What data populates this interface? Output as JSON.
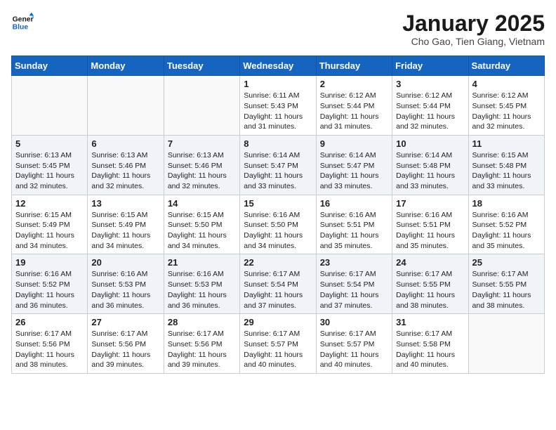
{
  "header": {
    "logo_line1": "General",
    "logo_line2": "Blue",
    "title": "January 2025",
    "location": "Cho Gao, Tien Giang, Vietnam"
  },
  "days_of_week": [
    "Sunday",
    "Monday",
    "Tuesday",
    "Wednesday",
    "Thursday",
    "Friday",
    "Saturday"
  ],
  "weeks": [
    [
      {
        "day": "",
        "sunrise": "",
        "sunset": "",
        "daylight": ""
      },
      {
        "day": "",
        "sunrise": "",
        "sunset": "",
        "daylight": ""
      },
      {
        "day": "",
        "sunrise": "",
        "sunset": "",
        "daylight": ""
      },
      {
        "day": "1",
        "sunrise": "Sunrise: 6:11 AM",
        "sunset": "Sunset: 5:43 PM",
        "daylight": "Daylight: 11 hours and 31 minutes."
      },
      {
        "day": "2",
        "sunrise": "Sunrise: 6:12 AM",
        "sunset": "Sunset: 5:44 PM",
        "daylight": "Daylight: 11 hours and 31 minutes."
      },
      {
        "day": "3",
        "sunrise": "Sunrise: 6:12 AM",
        "sunset": "Sunset: 5:44 PM",
        "daylight": "Daylight: 11 hours and 32 minutes."
      },
      {
        "day": "4",
        "sunrise": "Sunrise: 6:12 AM",
        "sunset": "Sunset: 5:45 PM",
        "daylight": "Daylight: 11 hours and 32 minutes."
      }
    ],
    [
      {
        "day": "5",
        "sunrise": "Sunrise: 6:13 AM",
        "sunset": "Sunset: 5:45 PM",
        "daylight": "Daylight: 11 hours and 32 minutes."
      },
      {
        "day": "6",
        "sunrise": "Sunrise: 6:13 AM",
        "sunset": "Sunset: 5:46 PM",
        "daylight": "Daylight: 11 hours and 32 minutes."
      },
      {
        "day": "7",
        "sunrise": "Sunrise: 6:13 AM",
        "sunset": "Sunset: 5:46 PM",
        "daylight": "Daylight: 11 hours and 32 minutes."
      },
      {
        "day": "8",
        "sunrise": "Sunrise: 6:14 AM",
        "sunset": "Sunset: 5:47 PM",
        "daylight": "Daylight: 11 hours and 33 minutes."
      },
      {
        "day": "9",
        "sunrise": "Sunrise: 6:14 AM",
        "sunset": "Sunset: 5:47 PM",
        "daylight": "Daylight: 11 hours and 33 minutes."
      },
      {
        "day": "10",
        "sunrise": "Sunrise: 6:14 AM",
        "sunset": "Sunset: 5:48 PM",
        "daylight": "Daylight: 11 hours and 33 minutes."
      },
      {
        "day": "11",
        "sunrise": "Sunrise: 6:15 AM",
        "sunset": "Sunset: 5:48 PM",
        "daylight": "Daylight: 11 hours and 33 minutes."
      }
    ],
    [
      {
        "day": "12",
        "sunrise": "Sunrise: 6:15 AM",
        "sunset": "Sunset: 5:49 PM",
        "daylight": "Daylight: 11 hours and 34 minutes."
      },
      {
        "day": "13",
        "sunrise": "Sunrise: 6:15 AM",
        "sunset": "Sunset: 5:49 PM",
        "daylight": "Daylight: 11 hours and 34 minutes."
      },
      {
        "day": "14",
        "sunrise": "Sunrise: 6:15 AM",
        "sunset": "Sunset: 5:50 PM",
        "daylight": "Daylight: 11 hours and 34 minutes."
      },
      {
        "day": "15",
        "sunrise": "Sunrise: 6:16 AM",
        "sunset": "Sunset: 5:50 PM",
        "daylight": "Daylight: 11 hours and 34 minutes."
      },
      {
        "day": "16",
        "sunrise": "Sunrise: 6:16 AM",
        "sunset": "Sunset: 5:51 PM",
        "daylight": "Daylight: 11 hours and 35 minutes."
      },
      {
        "day": "17",
        "sunrise": "Sunrise: 6:16 AM",
        "sunset": "Sunset: 5:51 PM",
        "daylight": "Daylight: 11 hours and 35 minutes."
      },
      {
        "day": "18",
        "sunrise": "Sunrise: 6:16 AM",
        "sunset": "Sunset: 5:52 PM",
        "daylight": "Daylight: 11 hours and 35 minutes."
      }
    ],
    [
      {
        "day": "19",
        "sunrise": "Sunrise: 6:16 AM",
        "sunset": "Sunset: 5:52 PM",
        "daylight": "Daylight: 11 hours and 36 minutes."
      },
      {
        "day": "20",
        "sunrise": "Sunrise: 6:16 AM",
        "sunset": "Sunset: 5:53 PM",
        "daylight": "Daylight: 11 hours and 36 minutes."
      },
      {
        "day": "21",
        "sunrise": "Sunrise: 6:16 AM",
        "sunset": "Sunset: 5:53 PM",
        "daylight": "Daylight: 11 hours and 36 minutes."
      },
      {
        "day": "22",
        "sunrise": "Sunrise: 6:17 AM",
        "sunset": "Sunset: 5:54 PM",
        "daylight": "Daylight: 11 hours and 37 minutes."
      },
      {
        "day": "23",
        "sunrise": "Sunrise: 6:17 AM",
        "sunset": "Sunset: 5:54 PM",
        "daylight": "Daylight: 11 hours and 37 minutes."
      },
      {
        "day": "24",
        "sunrise": "Sunrise: 6:17 AM",
        "sunset": "Sunset: 5:55 PM",
        "daylight": "Daylight: 11 hours and 38 minutes."
      },
      {
        "day": "25",
        "sunrise": "Sunrise: 6:17 AM",
        "sunset": "Sunset: 5:55 PM",
        "daylight": "Daylight: 11 hours and 38 minutes."
      }
    ],
    [
      {
        "day": "26",
        "sunrise": "Sunrise: 6:17 AM",
        "sunset": "Sunset: 5:56 PM",
        "daylight": "Daylight: 11 hours and 38 minutes."
      },
      {
        "day": "27",
        "sunrise": "Sunrise: 6:17 AM",
        "sunset": "Sunset: 5:56 PM",
        "daylight": "Daylight: 11 hours and 39 minutes."
      },
      {
        "day": "28",
        "sunrise": "Sunrise: 6:17 AM",
        "sunset": "Sunset: 5:56 PM",
        "daylight": "Daylight: 11 hours and 39 minutes."
      },
      {
        "day": "29",
        "sunrise": "Sunrise: 6:17 AM",
        "sunset": "Sunset: 5:57 PM",
        "daylight": "Daylight: 11 hours and 40 minutes."
      },
      {
        "day": "30",
        "sunrise": "Sunrise: 6:17 AM",
        "sunset": "Sunset: 5:57 PM",
        "daylight": "Daylight: 11 hours and 40 minutes."
      },
      {
        "day": "31",
        "sunrise": "Sunrise: 6:17 AM",
        "sunset": "Sunset: 5:58 PM",
        "daylight": "Daylight: 11 hours and 40 minutes."
      },
      {
        "day": "",
        "sunrise": "",
        "sunset": "",
        "daylight": ""
      }
    ]
  ]
}
